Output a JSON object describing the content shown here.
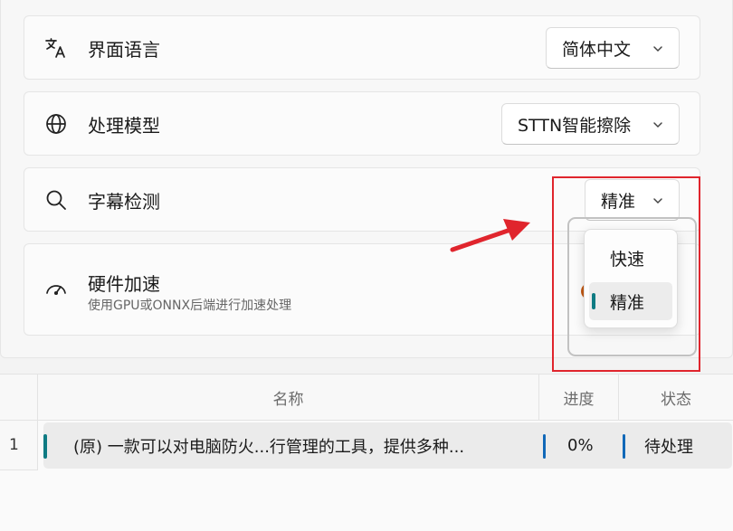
{
  "settings": {
    "language": {
      "icon": "translate-icon",
      "label": "界面语言",
      "value": "简体中文"
    },
    "model": {
      "icon": "globe-icon",
      "label": "处理模型",
      "value": "STTN智能擦除"
    },
    "detection": {
      "icon": "search-icon",
      "label": "字幕检测",
      "value": "精准",
      "options": [
        "快速",
        "精准"
      ],
      "selected": "精准"
    },
    "hardware": {
      "icon": "speedometer-icon",
      "label": "硬件加速",
      "description": "使用GPU或ONNX后端进行加速处理"
    }
  },
  "colors": {
    "accent": "#0f7b83",
    "progress_bar": "#1168b8",
    "annotation_red": "#e0252d",
    "toggle_on": "#c25a16"
  },
  "table": {
    "columns": [
      "名称",
      "进度",
      "状态"
    ],
    "rows": [
      {
        "index": "1",
        "name": "(原) 一款可以对电脑防火...行管理的工具，提供多种...",
        "progress": "0%",
        "status": "待处理"
      }
    ]
  }
}
